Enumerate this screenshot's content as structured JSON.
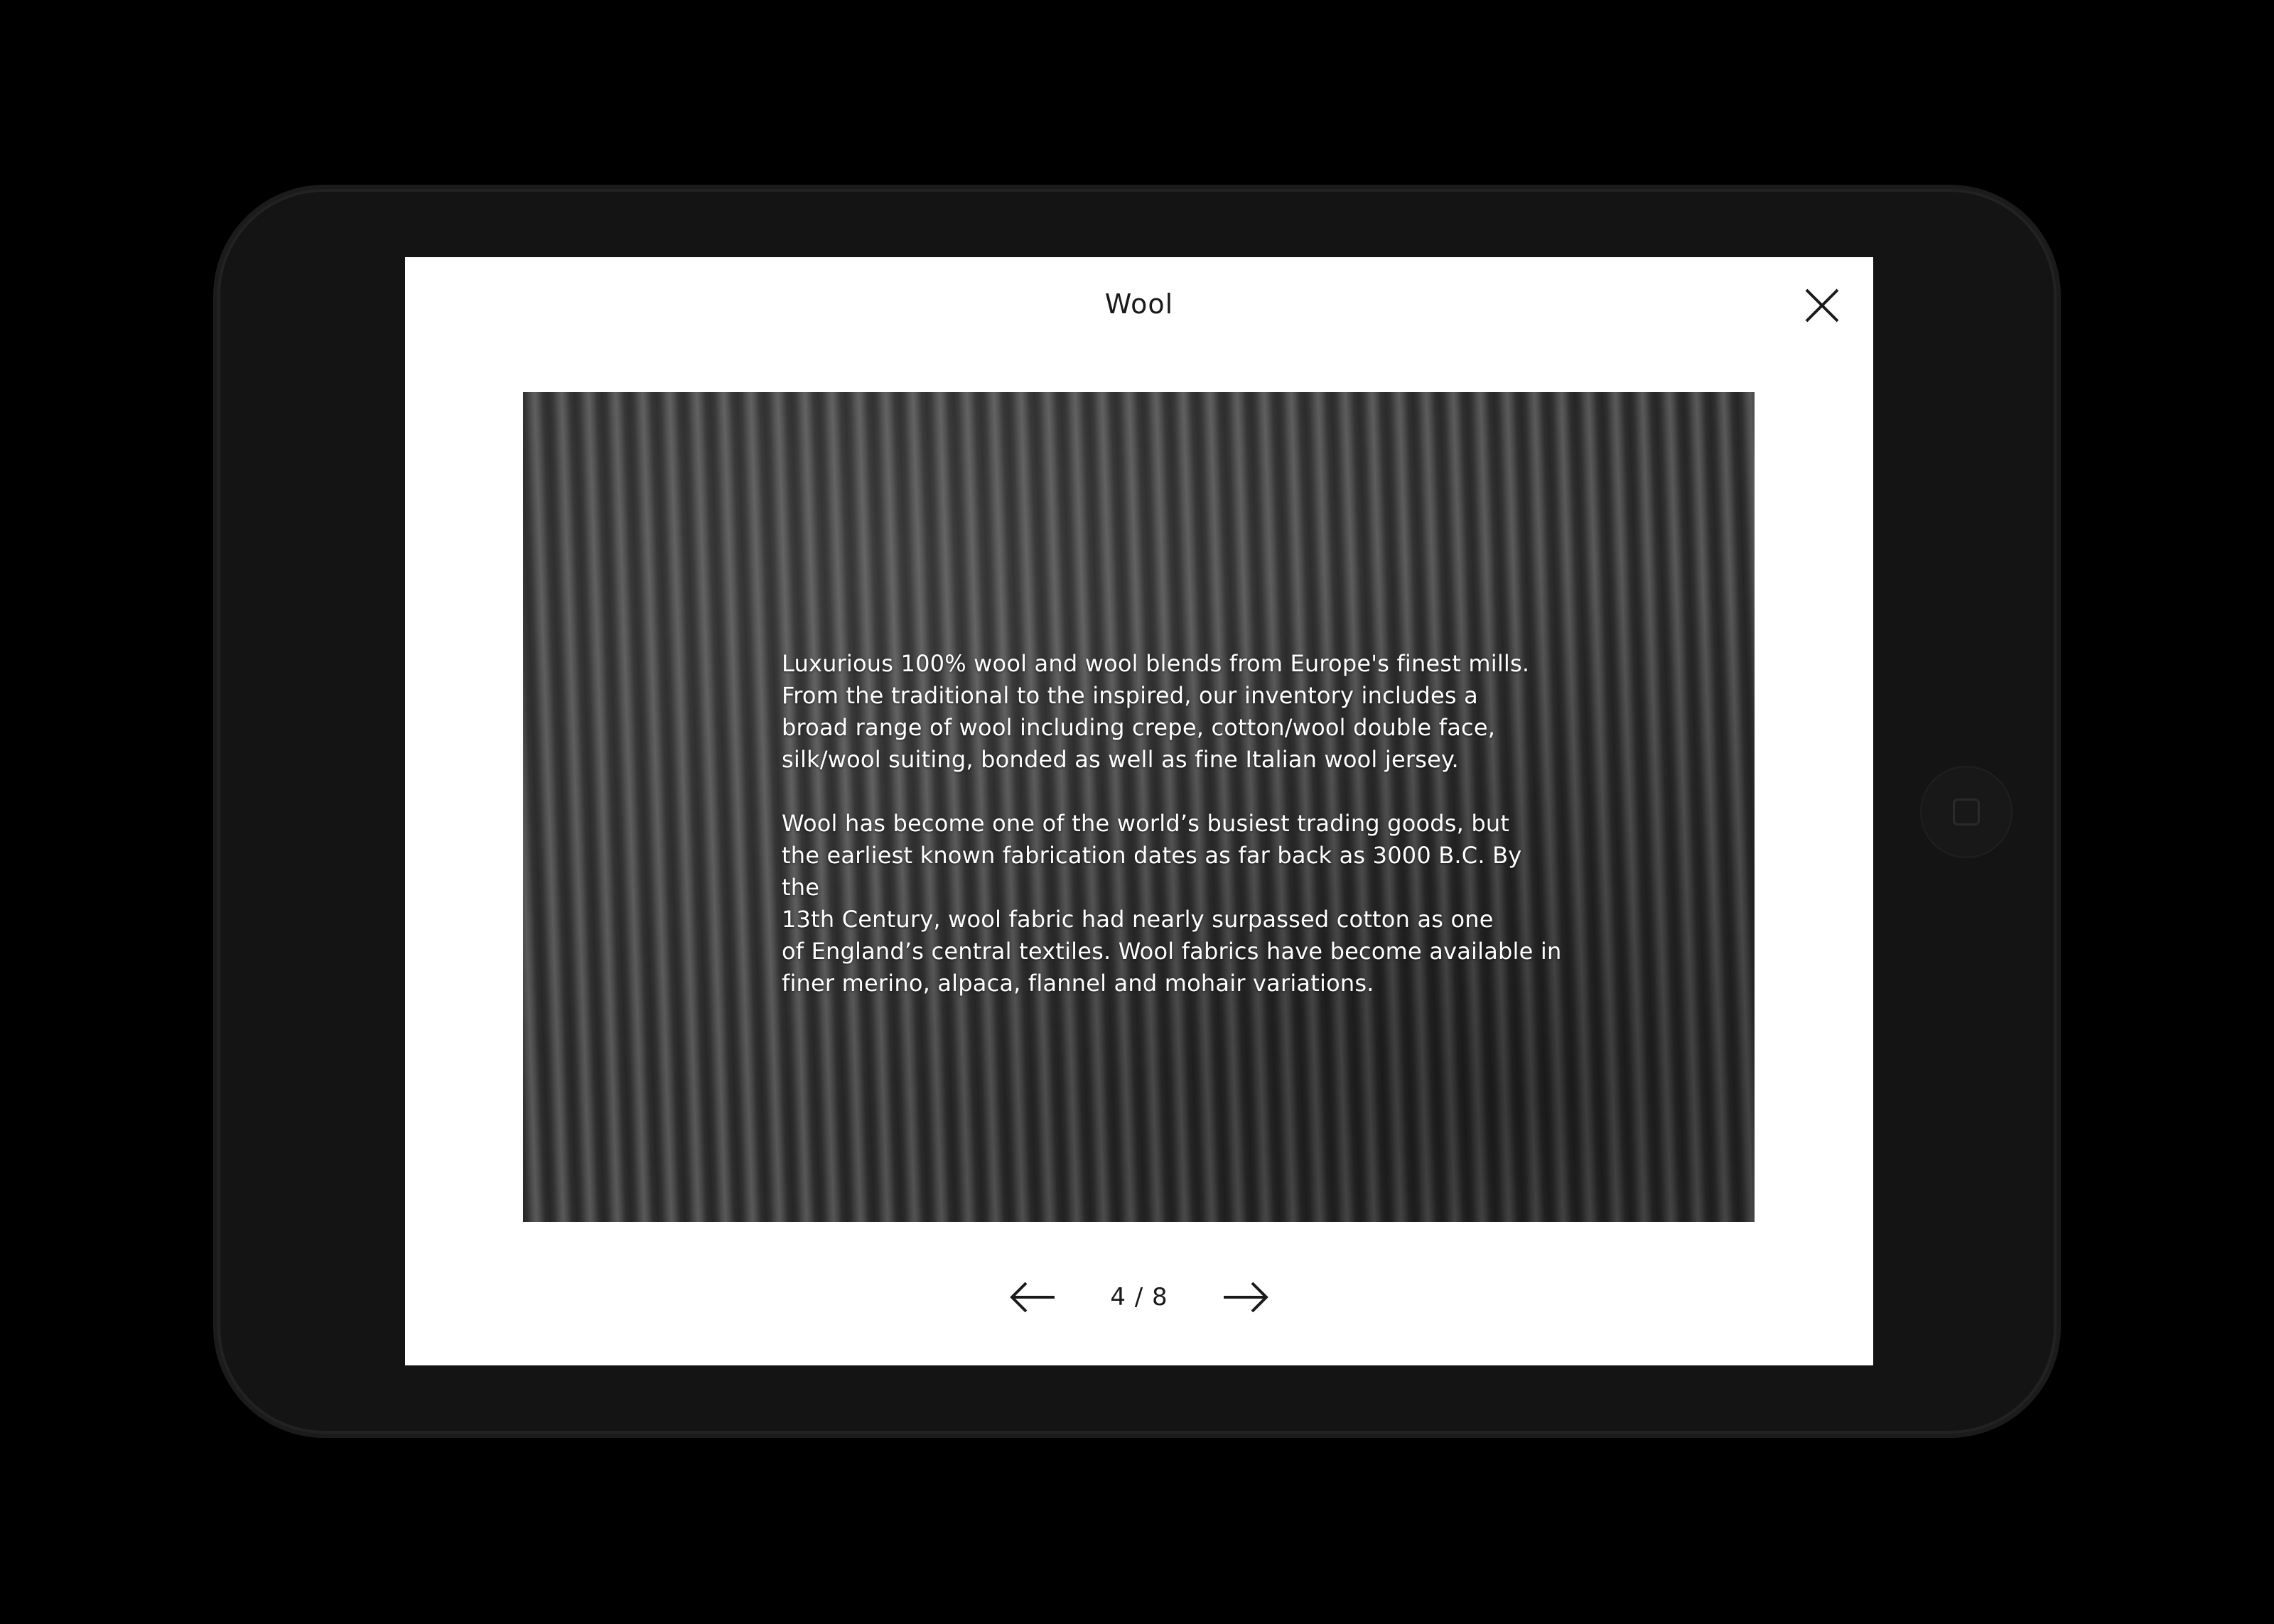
{
  "modal": {
    "title": "Wool",
    "close_icon": "close-icon"
  },
  "content": {
    "image": "knit-wool-texture",
    "paragraphs": [
      "Luxurious 100% wool and wool blends from Europe's finest mills.\nFrom the traditional to the inspired, our inventory includes a\nbroad range of wool including crepe, cotton/wool double face,\nsilk/wool suiting, bonded as well as fine Italian wool jersey.",
      "Wool has become one of the world’s busiest trading goods, but\nthe earliest known fabrication dates as far back as 3000 B.C. By the\n13th Century, wool fabric had nearly surpassed cotton as one\nof England’s central textiles. Wool fabrics have become available in\nfiner merino, alpaca, flannel and mohair variations."
    ]
  },
  "pagination": {
    "label": "4 / 8",
    "current": 4,
    "total": 8,
    "prev_icon": "arrow-left-icon",
    "next_icon": "arrow-right-icon"
  },
  "colors": {
    "page_background": "#000000",
    "device_bezel": "#141414",
    "modal_background": "#ffffff",
    "text_dark": "#1a1a1a",
    "text_light": "#ffffff"
  }
}
